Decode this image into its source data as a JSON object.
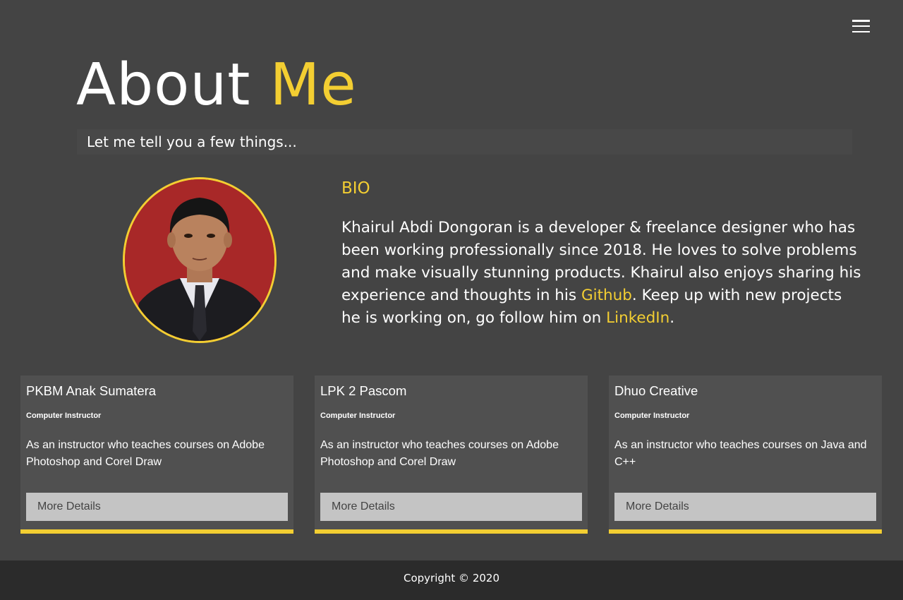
{
  "nav": {
    "menu_icon": "hamburger-menu-icon"
  },
  "header": {
    "title_main": "About",
    "title_accent": "Me",
    "subtitle": "Let me tell you a few things..."
  },
  "bio": {
    "heading": "BIO",
    "text_1": "Khairul Abdi Dongoran is a developer & freelance designer who has been working professionally since 2018. He loves to solve problems and make visually stunning products. Khairul also enjoys sharing his experience and thoughts in his ",
    "github_link": "Github",
    "text_2": ". Keep up with new projects he is working on, go follow him on ",
    "linkedin_link": "LinkedIn",
    "text_3": "."
  },
  "cards": [
    {
      "title": "PKBM Anak Sumatera",
      "role": "Computer Instructor",
      "description": "As an instructor who teaches courses on Adobe Photoshop and Corel Draw",
      "button": "More Details"
    },
    {
      "title": "LPK 2 Pascom",
      "role": "Computer Instructor",
      "description": "As an instructor who teaches courses on Adobe Photoshop and Corel Draw",
      "button": "More Details"
    },
    {
      "title": "Dhuo Creative",
      "role": "Computer Instructor",
      "description": "As an instructor who teaches courses on Java and C++",
      "button": "More Details"
    }
  ],
  "footer": {
    "copyright": "Copyright © 2020"
  },
  "colors": {
    "background": "#444444",
    "accent": "#f3ce32",
    "card_background": "#505050",
    "button_background": "#c4c4c4",
    "footer_background": "#2b2b2b"
  }
}
